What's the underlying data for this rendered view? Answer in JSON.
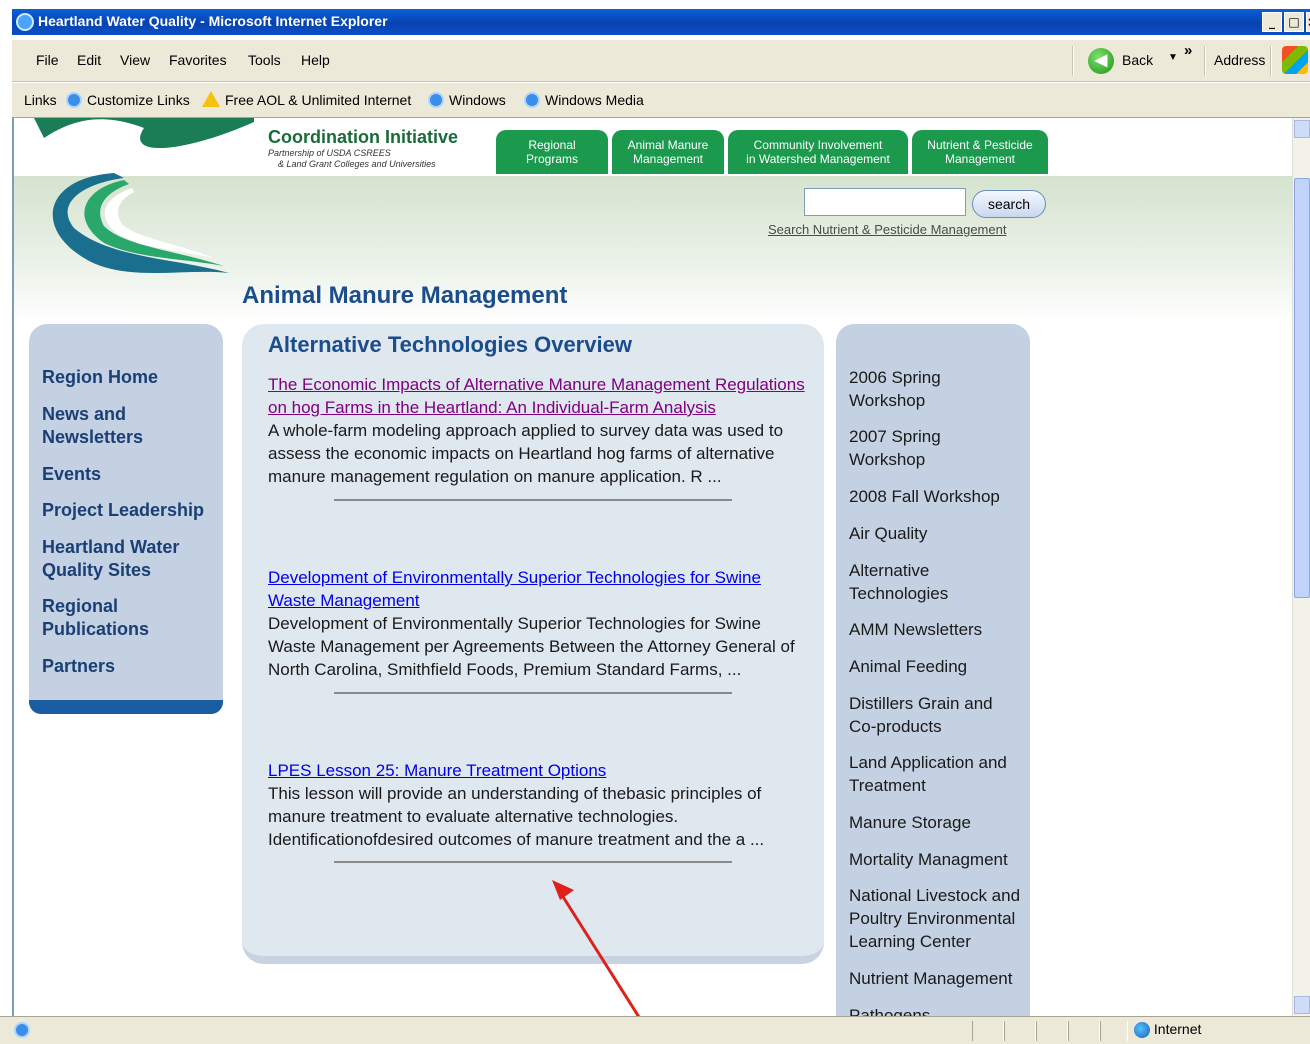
{
  "window": {
    "title": "Heartland Water Quality - Microsoft Internet Explorer",
    "controls": [
      "_",
      "□",
      "×"
    ]
  },
  "menubar": {
    "items": [
      "File",
      "Edit",
      "View",
      "Favorites",
      "Tools",
      "Help"
    ],
    "back_label": "Back",
    "overflow_label": "»",
    "address_label": "Address"
  },
  "linksbar": {
    "label": "Links",
    "items": [
      "Customize Links",
      "Free AOL & Unlimited Internet",
      "Windows",
      "Windows Media"
    ]
  },
  "site": {
    "logo_title": "Coordination Initiative",
    "logo_sub1": "Partnership of USDA CSREES",
    "logo_sub2": "& Land Grant Colleges and Universities",
    "tabs": [
      {
        "line1": "Regional",
        "line2": "Programs"
      },
      {
        "line1": "Animal Manure",
        "line2": "Management"
      },
      {
        "line1": "Community Involvement",
        "line2": "in Watershed Management"
      },
      {
        "line1": "Nutrient & Pesticide",
        "line2": "Management"
      }
    ],
    "search_button": "search",
    "search_value": "",
    "search_link": "Search Nutrient & Pesticide Management",
    "page_title": "Animal Manure Management"
  },
  "leftnav": {
    "items": [
      "Region Home",
      "News and Newsletters",
      "Events",
      "Project Leadership",
      "Heartland Water Quality Sites",
      "Regional Publications",
      "Partners"
    ]
  },
  "main": {
    "heading": "Alternative Technologies Overview",
    "articles": [
      {
        "title": "The Economic Impacts of Alternative Manure Management Regulations on hog Farms in the Heartland: An Individual-Farm Analysis",
        "desc": "A whole-farm modeling approach applied to survey data was used to assess the economic impacts on Heartland hog farms of alternative manure management regulation on manure application. R ...",
        "visited": true
      },
      {
        "title": "Development of Environmentally Superior Technologies for Swine Waste Management",
        "desc": "Development of Environmentally Superior Technologies for Swine Waste Management per Agreements Between the Attorney General of North Carolina, Smithfield Foods, Premium Standard Farms, ...",
        "visited": false
      },
      {
        "title": "LPES Lesson 25: Manure Treatment Options",
        "desc": "This lesson will provide an understanding of thebasic principles of manure treatment to evaluate alternative technologies. Identificationofdesired outcomes of manure treatment and the a ...",
        "visited": false
      }
    ]
  },
  "rightnav": {
    "items": [
      "2006 Spring Workshop",
      "2007 Spring Workshop",
      "2008 Fall Workshop",
      "Air Quality",
      "Alternative Technologies",
      "AMM Newsletters",
      "Animal Feeding",
      "Distillers Grain and Co-products",
      "Land Application and Treatment",
      "Manure Storage",
      "Mortality Managment",
      "National Livestock and Poultry Environmental Learning Center",
      "Nutrient Management",
      "Pathogens"
    ]
  },
  "statusbar": {
    "zone": "Internet"
  },
  "colors": {
    "tab_green": "#1b9a4e",
    "nav_blue": "#c3d1e2",
    "title_blue": "#1b4d8c",
    "annotation_arrow": "#e0201a"
  }
}
